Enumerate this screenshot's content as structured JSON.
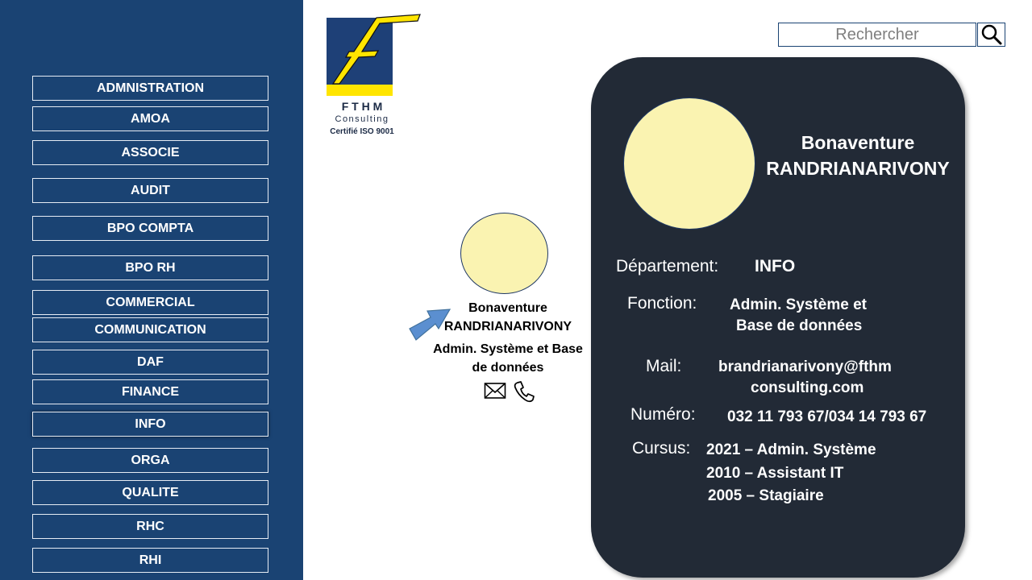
{
  "sidebar": {
    "items": [
      {
        "label": "ADMNISTRATION"
      },
      {
        "label": "AMOA"
      },
      {
        "label": "ASSOCIE"
      },
      {
        "label": "AUDIT"
      },
      {
        "label": "BPO COMPTA"
      },
      {
        "label": "BPO RH"
      },
      {
        "label": "COMMERCIAL"
      },
      {
        "label": "COMMUNICATION"
      },
      {
        "label": "DAF"
      },
      {
        "label": "FINANCE"
      },
      {
        "label": "INFO"
      },
      {
        "label": "ORGA"
      },
      {
        "label": "QUALITE"
      },
      {
        "label": "RHC"
      },
      {
        "label": "RHI"
      }
    ],
    "selected": "INFO"
  },
  "logo": {
    "letter": "F",
    "name": "F T H M",
    "sub": "Consulting",
    "cert": "Certifié ISO 9001"
  },
  "search": {
    "placeholder": "Rechercher",
    "icon": "search-icon"
  },
  "employee_card": {
    "first_name": "Bonaventure",
    "last_name": "RANDRIANARIVONY",
    "function_line1": "Admin. Système et Base",
    "function_line2": "de données",
    "icons": [
      "mail-icon",
      "phone-icon"
    ]
  },
  "detail": {
    "first_name": "Bonaventure",
    "last_name": "RANDRIANARIVONY",
    "department_label": "Département:",
    "department_value": "INFO",
    "function_label": "Fonction:",
    "function_line1": "Admin. Système et",
    "function_line2": "Base de données",
    "mail_label": "Mail:",
    "mail_line1": "brandrianarivony@fthm",
    "mail_line2": "consulting.com",
    "number_label": "Numéro:",
    "number_value": "032 11 793 67/034 14 793 67",
    "cursus_label": "Cursus:",
    "cursus": [
      "2021 – Admin. Système",
      "2010 – Assistant IT",
      "2005 – Stagiaire"
    ]
  },
  "colors": {
    "sidebar": "#1a4373",
    "card": "#222a36",
    "avatar": "#faf3b1",
    "logo_yellow": "#ffe500",
    "logo_blue": "#1e4077",
    "arrow": "#5b8fd0"
  }
}
